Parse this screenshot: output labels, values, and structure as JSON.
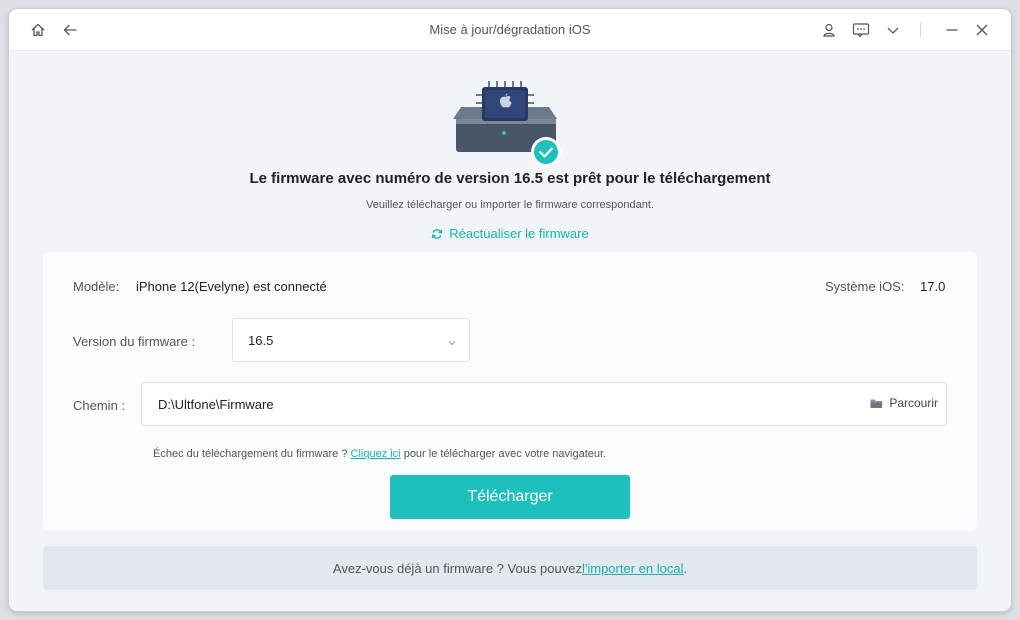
{
  "window": {
    "title": "Mise à jour/dégradation iOS"
  },
  "hero": {
    "heading": "Le firmware avec numéro de version 16.5 est prêt pour le téléchargement",
    "subheading": "Veuillez télécharger ou importer le firmware correspondant.",
    "refresh_label": "Réactualiser le firmware",
    "illustration_icon": "firmware-chip-ready-icon"
  },
  "device": {
    "model_label": "Modèle:",
    "model_value": "iPhone 12(Evelyne) est connecté",
    "ios_label": "Système iOS:",
    "ios_value": "17.0"
  },
  "firmware": {
    "version_label": "Version du firmware :",
    "version_selected": "16.5"
  },
  "path": {
    "label": "Chemin :",
    "value": "D:\\Ultfone\\Firmware",
    "browse_label": "Parcourir"
  },
  "help": {
    "prefix": "Échec du téléchargement du firmware ? ",
    "link": "Cliquez ici",
    "suffix": " pour le télécharger avec votre navigateur."
  },
  "actions": {
    "download_label": "Télécharger"
  },
  "footer": {
    "prefix": "Avez-vous déjà un firmware ? Vous pouvez ",
    "link": "l'importer en local",
    "suffix": "."
  },
  "colors": {
    "accent": "#1ec0bd",
    "link": "#17b3b0",
    "background": "#f1f4f9"
  }
}
